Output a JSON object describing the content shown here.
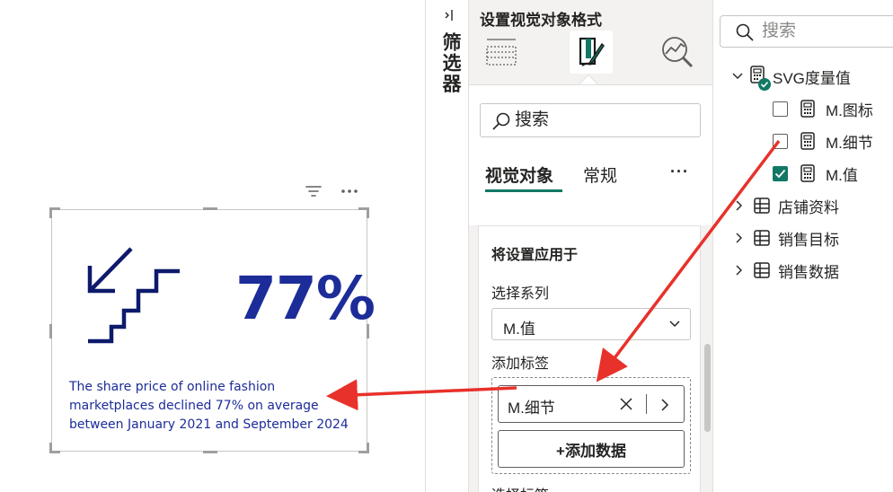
{
  "visual": {
    "kpi_value": "77%",
    "caption": "The share price of online fashion marketplaces declined 77% on average between January 2021 and September 2024",
    "icon": "stairs-down-arrow-icon",
    "accent_color": "#1c2c98"
  },
  "filters": {
    "label": "筛选器"
  },
  "format_pane": {
    "title": "设置视觉对象格式",
    "search_placeholder": "搜索",
    "tabs": {
      "visual": "视觉对象",
      "general": "常规",
      "more": "···"
    },
    "section_title": "将设置应用于",
    "series_label": "选择系列",
    "series_value": "M.值",
    "tag_label": "添加标签",
    "field_chip": "M.细节",
    "add_data_button": "+添加数据",
    "next_label": "选择标签"
  },
  "data_pane": {
    "search_placeholder": "搜索",
    "tree": {
      "svg_table": "SVG度量值",
      "m_icon": "M.图标",
      "m_detail": "M.细节",
      "m_value": "M.值",
      "store_info": "店铺资料",
      "sales_target": "销售目标",
      "sales_data": "销售数据"
    },
    "checked": {
      "m_icon": false,
      "m_detail": false,
      "m_value": true
    }
  },
  "colors": {
    "annotation_arrow": "#e8312a",
    "checked_accent": "#117865",
    "kpi_blue": "#1c2c98",
    "stairs_navy": "#0e1a6b"
  }
}
